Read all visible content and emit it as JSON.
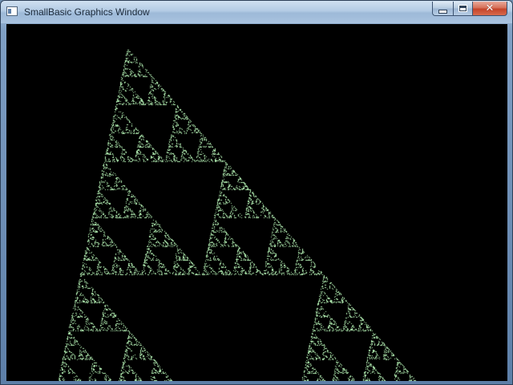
{
  "window": {
    "title": "SmallBasic Graphics Window",
    "icon": "app-window-icon",
    "controls": {
      "minimize_icon": "minimize-icon",
      "maximize_icon": "maximize-icon",
      "close_icon": "close-icon",
      "close_glyph": "✕"
    }
  },
  "canvas": {
    "background_color": "#000000",
    "fractal": {
      "type": "sierpinski-triangle",
      "color": "#b4f0b4"
    }
  }
}
